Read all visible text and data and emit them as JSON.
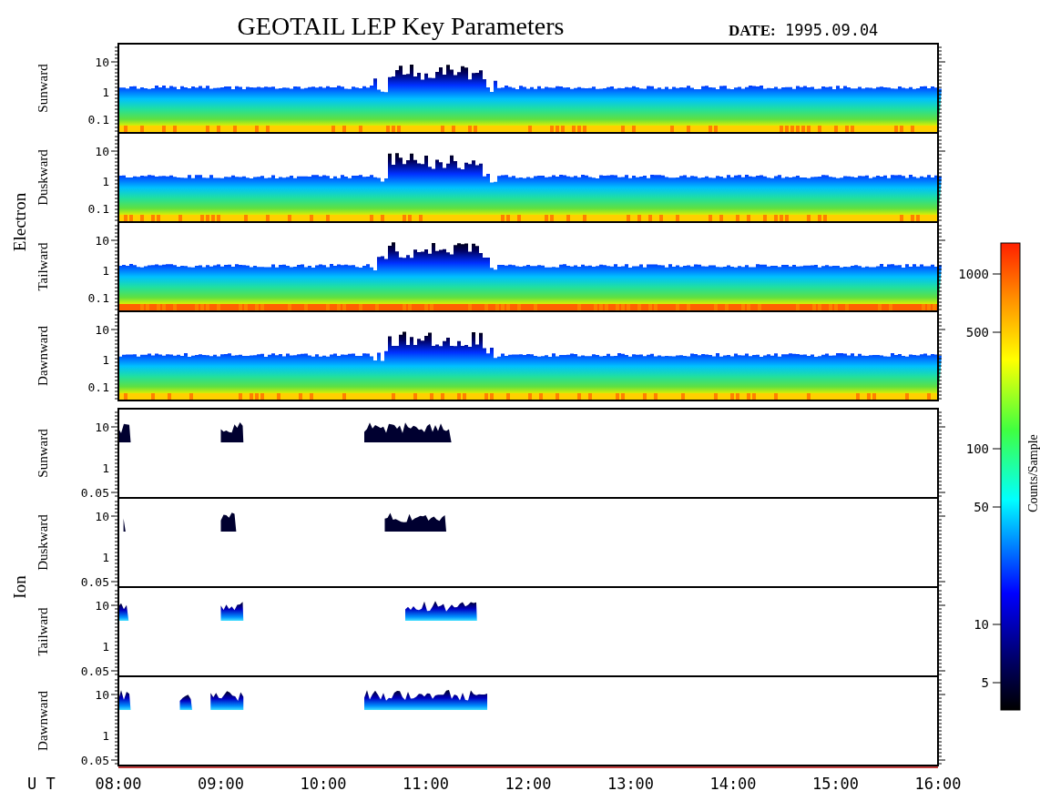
{
  "title": "GEOTAIL LEP Key Parameters",
  "date": {
    "label": "DATE:",
    "value": "1995.09.04"
  },
  "groups": [
    {
      "name": "Electron",
      "kind": "electron",
      "panels": [
        {
          "direction": "Sunward",
          "yticks": [
            "10",
            "1",
            "0.1"
          ]
        },
        {
          "direction": "Duskward",
          "yticks": [
            "10",
            "1",
            "0.1"
          ]
        },
        {
          "direction": "Tailward",
          "yticks": [
            "10",
            "1",
            "0.1"
          ]
        },
        {
          "direction": "Dawnward",
          "yticks": [
            "10",
            "1",
            "0.1"
          ]
        }
      ]
    },
    {
      "name": "Ion",
      "kind": "ion",
      "panels": [
        {
          "direction": "Sunward",
          "yticks": [
            "10",
            "1",
            "0.05"
          ]
        },
        {
          "direction": "Duskward",
          "yticks": [
            "10",
            "1",
            "0.05"
          ]
        },
        {
          "direction": "Tailward",
          "yticks": [
            "10",
            "1",
            "0.05"
          ]
        },
        {
          "direction": "Dawnward",
          "yticks": [
            "10",
            "1",
            "0.05"
          ]
        }
      ]
    }
  ],
  "colorbar": {
    "label": "Counts/Sample",
    "ticks": [
      "1000",
      "500",
      "100",
      "50",
      "10",
      "5"
    ]
  },
  "xaxis": {
    "label": "U T",
    "ticks": [
      "08:00",
      "09:00",
      "10:00",
      "11:00",
      "12:00",
      "13:00",
      "14:00",
      "15:00",
      "16:00"
    ]
  }
}
